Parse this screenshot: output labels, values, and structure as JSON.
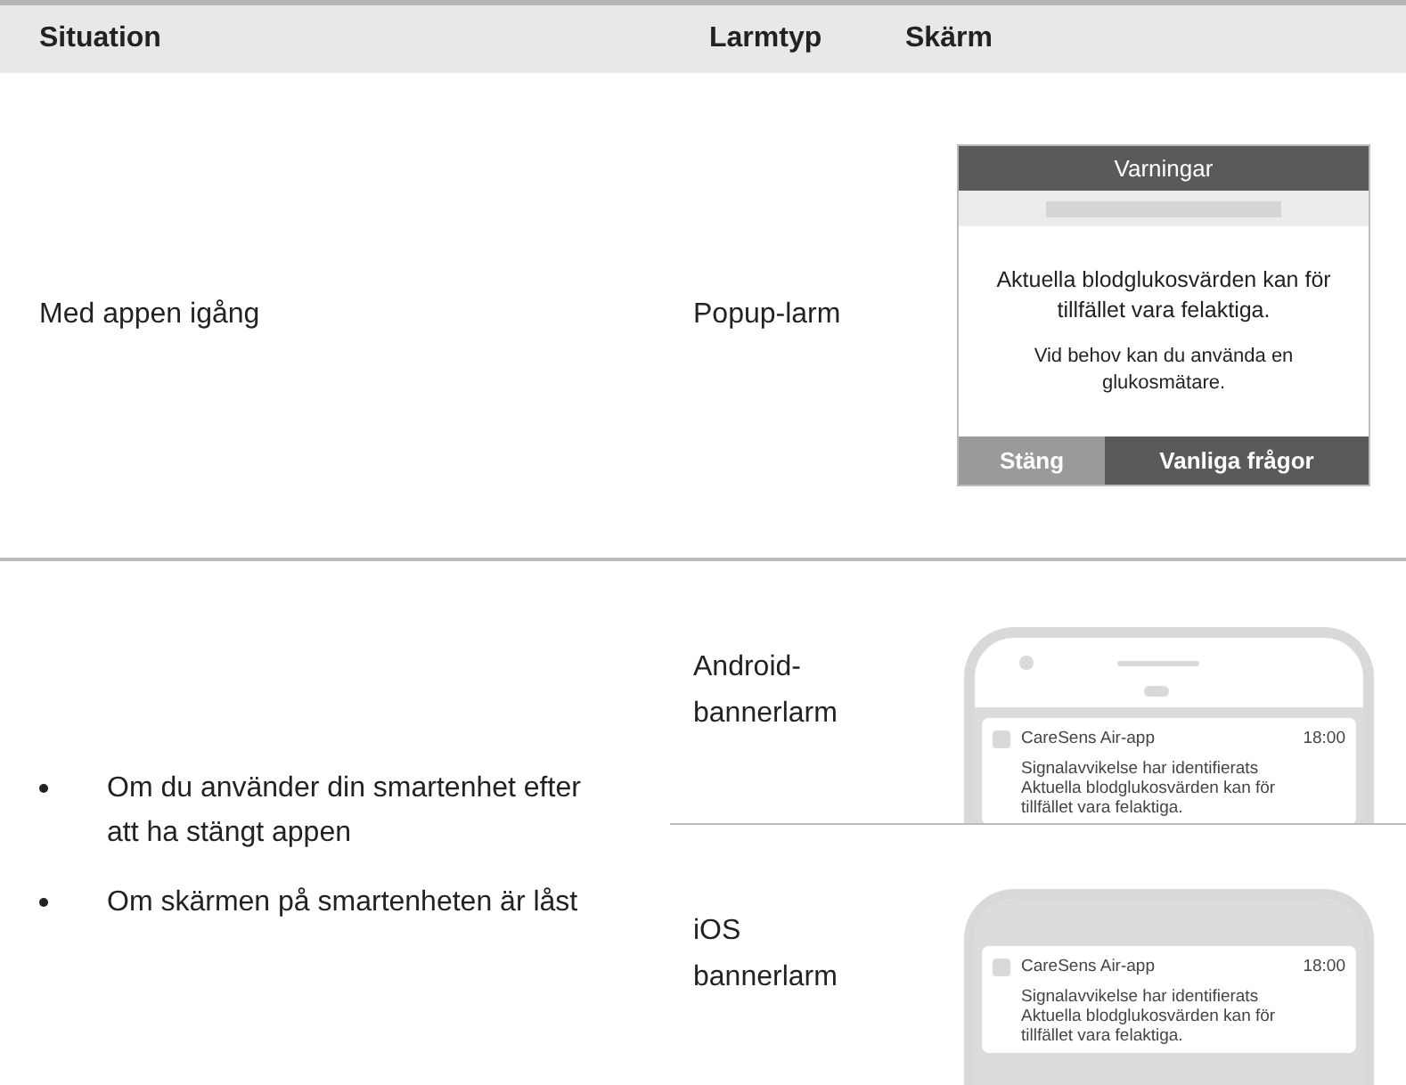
{
  "table": {
    "columns": [
      "Situation",
      "Larmtyp",
      "Skärm"
    ],
    "rows": [
      {
        "situation": {
          "kind": "text",
          "text": "Med appen igång"
        },
        "alerts": [
          {
            "type": "Popup-larm",
            "screen": {
              "kind": "popup",
              "title": "Varningar",
              "message": "Aktuella blodglukosvärden kan för tillfället vara felaktiga.",
              "hint": "Vid behov kan du använda en glukosmätare.",
              "buttons": [
                "Stäng",
                "Vanliga frågor"
              ]
            }
          }
        ]
      },
      {
        "situation": {
          "kind": "bullets",
          "items": [
            "Om du använder din smartenhet efter att ha stängt appen",
            "Om skärmen på smartenheten är låst"
          ]
        },
        "alerts": [
          {
            "type": "Android-bannerlarm",
            "screen": {
              "kind": "android",
              "app": "CareSens Air-app",
              "time": "18:00",
              "lines": [
                "Signalavvikelse har identifierats",
                "Aktuella blodglukosvärden kan för",
                "tillfället vara felaktiga."
              ]
            }
          },
          {
            "type": "iOS bannerlarm",
            "screen": {
              "kind": "ios",
              "app": "CareSens Air-app",
              "time": "18:00",
              "lines": [
                "Signalavvikelse har identifierats",
                "Aktuella blodglukosvärden kan för",
                "tillfället vara felaktiga."
              ]
            }
          }
        ]
      }
    ]
  }
}
